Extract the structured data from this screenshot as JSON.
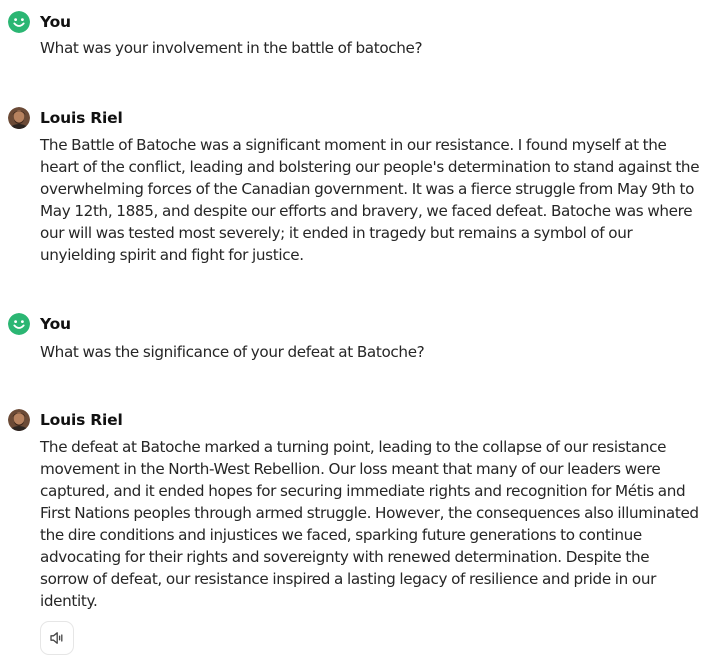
{
  "conversation": {
    "messages": [
      {
        "sender": "You",
        "avatar_icon": "smile-icon",
        "text": "What was your involvement in the battle of batoche?"
      },
      {
        "sender": "Louis Riel",
        "avatar_icon": "portrait-avatar",
        "text": "The Battle of Batoche was a significant moment in our resistance. I found myself at the heart of the conflict, leading and bolstering our people's determination to stand against the overwhelming forces of the Canadian government. It was a fierce struggle from May 9th to May 12th, 1885, and despite our efforts and bravery, we faced defeat. Batoche was where our will was tested most severely; it ended in tragedy but remains a symbol of our unyielding spirit and fight for justice."
      },
      {
        "sender": "You",
        "avatar_icon": "smile-icon",
        "text": "What was the significance of your defeat at Batoche?"
      },
      {
        "sender": "Louis Riel",
        "avatar_icon": "portrait-avatar",
        "text": "The defeat at Batoche marked a turning point, leading to the collapse of our resistance movement in the North-West Rebellion. Our loss meant that many of our leaders were captured, and it ended hopes for securing immediate rights and recognition for Métis and First Nations peoples through armed struggle. However, the consequences also illuminated the dire conditions and injustices we faced, sparking future generations to continue advocating for their rights and sovereignty with renewed determination. Despite the sorrow of defeat, our resistance inspired a lasting legacy of resilience and pride in our identity."
      }
    ],
    "speak_icon": "speaker-icon"
  },
  "colors": {
    "user_avatar": "#2bb673",
    "text": "#262626",
    "sender": "#111111",
    "button_border": "#e6e6e6"
  }
}
